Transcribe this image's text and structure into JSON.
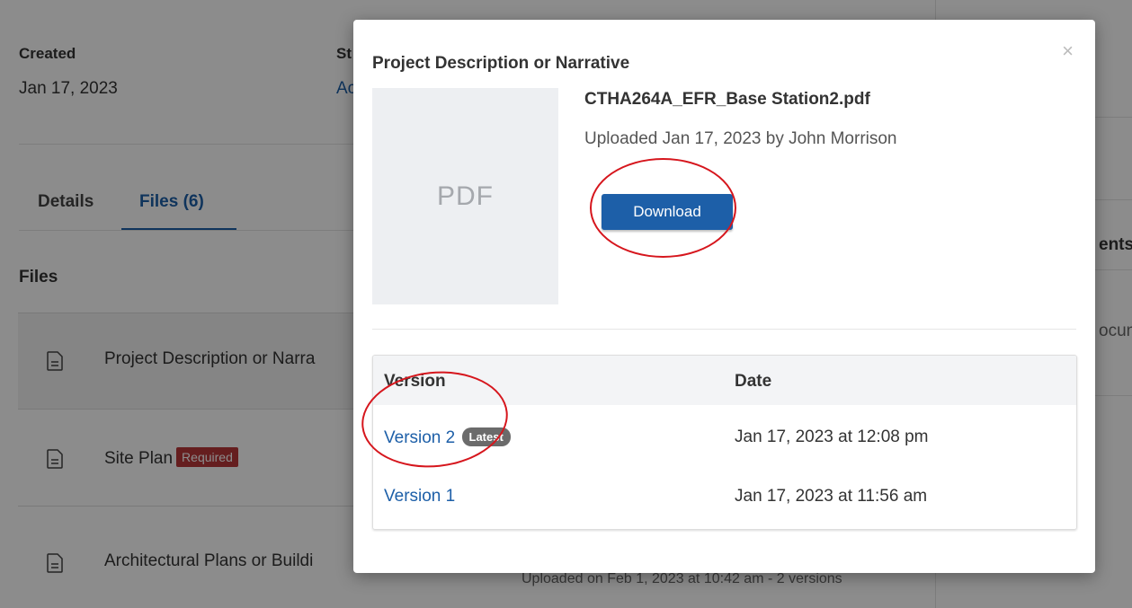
{
  "background": {
    "created_label": "Created",
    "created_value": "Jan 17, 2023",
    "status_label_fragment": "St",
    "status_value_fragment": "Ac",
    "tabs": [
      {
        "label": "Details",
        "active": false
      },
      {
        "label": "Files (6)",
        "active": true
      }
    ],
    "files_heading": "Files",
    "file_rows": [
      {
        "name": "Project Description or Narra",
        "required": false
      },
      {
        "name": "Site Plan",
        "required": true,
        "badge": "Required"
      },
      {
        "name": "Architectural Plans or Buildi",
        "required": false,
        "sub": "Uploaded on Feb 1, 2023 at 10:42 am - 2 versions"
      }
    ],
    "right_fragments": [
      "ents",
      "ocun"
    ]
  },
  "modal": {
    "title": "Project Description or Narrative",
    "close_icon": "close-icon",
    "thumbnail_text": "PDF",
    "file_name": "CTHA264A_EFR_Base Station2.pdf",
    "uploaded_info": "Uploaded Jan 17, 2023 by John Morrison",
    "download_label": "Download",
    "table": {
      "headers": {
        "version": "Version",
        "date": "Date"
      },
      "rows": [
        {
          "version": "Version 2",
          "badge": "Latest",
          "date": "Jan 17, 2023 at 12:08 pm"
        },
        {
          "version": "Version 1",
          "badge": "",
          "date": "Jan 17, 2023 at 11:56 am"
        }
      ]
    }
  },
  "colors": {
    "accent": "#1d5fa8",
    "required": "#b9373a",
    "annotation": "#d6161d"
  }
}
